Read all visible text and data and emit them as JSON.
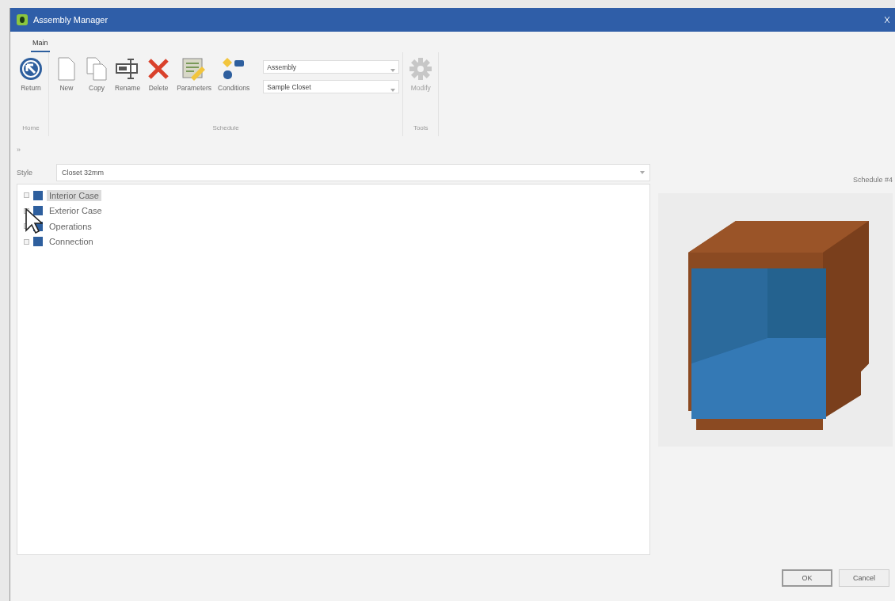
{
  "window": {
    "title": "Assembly Manager"
  },
  "ribbon": {
    "tabs": [
      {
        "label": "Main",
        "selected": true
      }
    ],
    "groups": [
      {
        "label": "Home",
        "items": [
          {
            "kind": "return",
            "label": "Return",
            "disabled": false
          }
        ]
      },
      {
        "label": "Schedule",
        "items": [
          {
            "kind": "new",
            "label": "New",
            "disabled": false
          },
          {
            "kind": "copy",
            "label": "Copy",
            "disabled": false
          },
          {
            "kind": "rename",
            "label": "Rename",
            "disabled": false
          },
          {
            "kind": "delete",
            "label": "Delete",
            "disabled": false
          },
          {
            "kind": "parameters",
            "label": "Parameters",
            "disabled": false
          },
          {
            "kind": "conditions",
            "label": "Conditions",
            "disabled": false
          },
          {
            "kind": "combos",
            "values": [
              "Assembly",
              "Sample Closet"
            ]
          }
        ]
      },
      {
        "label": "Tools",
        "items": [
          {
            "kind": "gear",
            "label": "Modify",
            "disabled": true
          }
        ]
      }
    ]
  },
  "collapse_toggle": "»",
  "style_field": {
    "label": "Style",
    "value": "Closet 32mm"
  },
  "tree": [
    {
      "label": "Interior Case",
      "selected": true
    },
    {
      "label": "Exterior Case",
      "selected": false
    },
    {
      "label": "Operations",
      "selected": false
    },
    {
      "label": "Connection",
      "selected": false
    }
  ],
  "preview": {
    "title": "Schedule #4"
  },
  "buttons": [
    "OK",
    "Cancel"
  ]
}
